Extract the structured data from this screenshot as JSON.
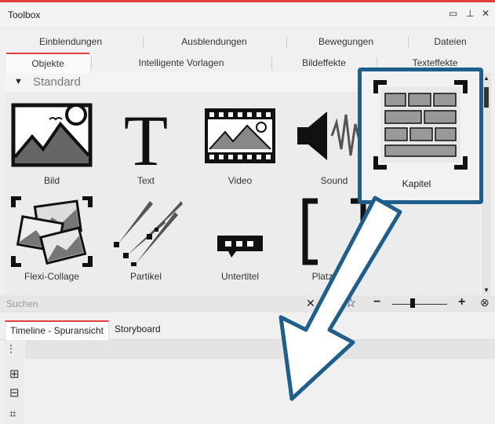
{
  "window": {
    "title": "Toolbox",
    "btn_min": "▭",
    "btn_pin": "⊥",
    "btn_close": "✕"
  },
  "tabs_row1": [
    "Einblendungen",
    "Ausblendungen",
    "Bewegungen",
    "Dateien"
  ],
  "tabs_row2": [
    "Objekte",
    "Intelligente Vorlagen",
    "Bildeffekte",
    "Texteffekte"
  ],
  "group": {
    "triangle": "▼",
    "label": "Standard"
  },
  "items": [
    {
      "label": "Bild",
      "icon": "picture-icon"
    },
    {
      "label": "Text",
      "icon": "text-icon"
    },
    {
      "label": "Video",
      "icon": "film-icon"
    },
    {
      "label": "Sound",
      "icon": "speaker-icon"
    },
    {
      "label": "Kapitel",
      "icon": "chapter-icon"
    },
    {
      "label": "Flexi-Collage",
      "icon": "collage-icon"
    },
    {
      "label": "Partikel",
      "icon": "particle-icon"
    },
    {
      "label": "Untertitel",
      "icon": "subtitle-icon"
    },
    {
      "label": "Platzhalter",
      "icon": "placeholder-icon"
    }
  ],
  "search": {
    "placeholder": "Suchen",
    "clear": "✕",
    "star": "☆",
    "minus": "−",
    "plus": "+",
    "zoom": "⊗"
  },
  "bottom_tabs": [
    "Timeline - Spuransicht",
    "Storyboard"
  ],
  "timeline_icons": [
    "waveform-icon",
    "add-track-icon",
    "remove-track-icon",
    "fit-icon"
  ],
  "colors": {
    "accent": "#e04040",
    "highlight": "#1d5e8c"
  }
}
